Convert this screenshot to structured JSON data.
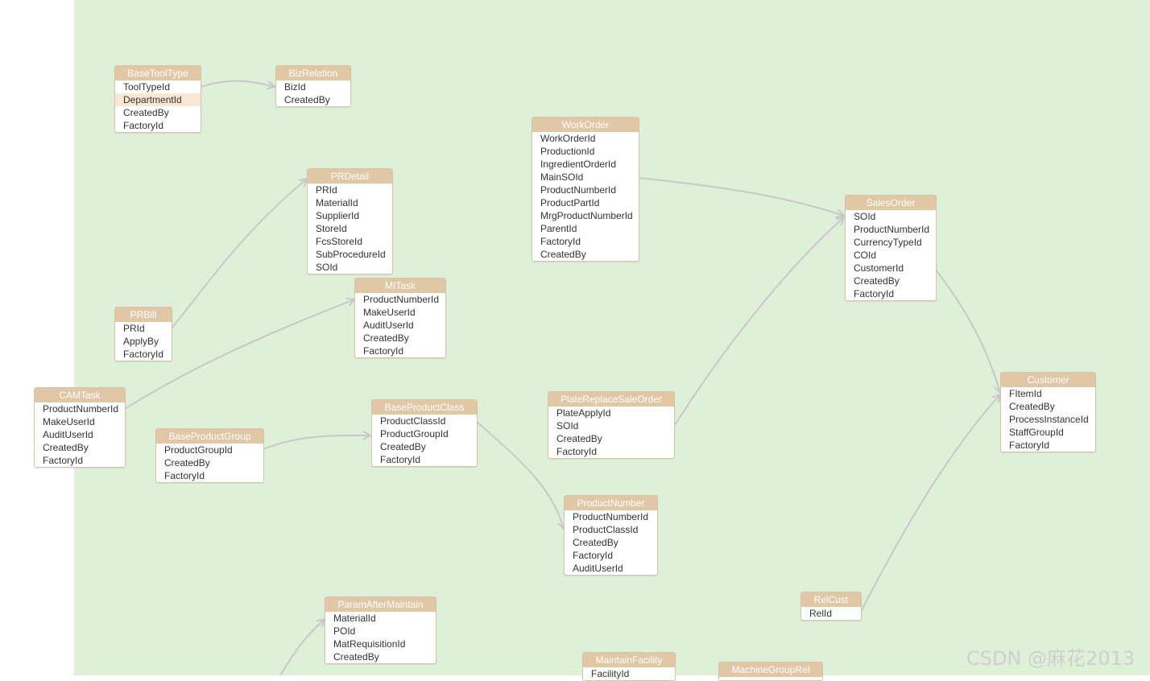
{
  "colors": {
    "canvas_bg": "#dff0d9",
    "header_bg": "#e0c7a6",
    "border": "#d7c3a7",
    "edge": "#c8c8c8",
    "highlight": "#f8e7d3"
  },
  "watermark": "CSDN @麻花2013",
  "tables": [
    {
      "id": "BaseToolType",
      "name": "BaseToolType",
      "fields": [
        "ToolTypeId",
        "DepartmentId",
        "CreatedBy",
        "FactoryId"
      ]
    },
    {
      "id": "BizRelation",
      "name": "BizRelation",
      "fields": [
        "BizId",
        "CreatedBy"
      ]
    },
    {
      "id": "WorkOrder",
      "name": "WorkOrder",
      "fields": [
        "WorkOrderId",
        "ProductionId",
        "IngredientOrderId",
        "MainSOId",
        "ProductNumberId",
        "ProductPartId",
        "MrgProductNumberId",
        "ParentId",
        "FactoryId",
        "CreatedBy"
      ]
    },
    {
      "id": "PRDetail",
      "name": "PRDetail",
      "fields": [
        "PRId",
        "MaterialId",
        "SupplierId",
        "StoreId",
        "FcsStoreId",
        "SubProcedureId",
        "SOId"
      ]
    },
    {
      "id": "SalesOrder",
      "name": "SalesOrder",
      "fields": [
        "SOId",
        "ProductNumberId",
        "CurrencyTypeId",
        "COId",
        "CustomerId",
        "CreatedBy",
        "FactoryId"
      ]
    },
    {
      "id": "MITask",
      "name": "MITask",
      "fields": [
        "ProductNumberId",
        "MakeUserId",
        "AuditUserId",
        "CreatedBy",
        "FactoryId"
      ]
    },
    {
      "id": "PRBill",
      "name": "PRBill",
      "fields": [
        "PRId",
        "ApplyBy",
        "FactoryId"
      ]
    },
    {
      "id": "CAMTask",
      "name": "CAMTask",
      "fields": [
        "ProductNumberId",
        "MakeUserId",
        "AuditUserId",
        "CreatedBy",
        "FactoryId"
      ]
    },
    {
      "id": "Customer",
      "name": "Customer",
      "fields": [
        "FItemId",
        "CreatedBy",
        "ProcessInstanceId",
        "StaffGroupId",
        "FactoryId"
      ]
    },
    {
      "id": "PlateReplaceSaleOrder",
      "name": "PlateReplaceSaleOrder",
      "fields": [
        "PlateApplyId",
        "SOId",
        "CreatedBy",
        "FactoryId"
      ]
    },
    {
      "id": "BaseProductClass",
      "name": "BaseProductClass",
      "fields": [
        "ProductClassId",
        "ProductGroupId",
        "CreatedBy",
        "FactoryId"
      ]
    },
    {
      "id": "BaseProductGroup",
      "name": "BaseProductGroup",
      "fields": [
        "ProductGroupId",
        "CreatedBy",
        "FactoryId"
      ]
    },
    {
      "id": "ProductNumber",
      "name": "ProductNumber",
      "fields": [
        "ProductNumberId",
        "ProductClassId",
        "CreatedBy",
        "FactoryId",
        "AuditUserId"
      ]
    },
    {
      "id": "RelCust",
      "name": "RelCust",
      "fields": [
        "RelId"
      ]
    },
    {
      "id": "ParamAfterMaintain",
      "name": "ParamAfterMaintain",
      "fields": [
        "MaterialId",
        "POId",
        "MatRequisitionId",
        "CreatedBy"
      ]
    },
    {
      "id": "MaintainFacility",
      "name": "MaintainFacility",
      "fields": [
        "FacilityId"
      ]
    },
    {
      "id": "MachineGroupRel",
      "name": "MachineGroupRel",
      "fields": []
    }
  ]
}
